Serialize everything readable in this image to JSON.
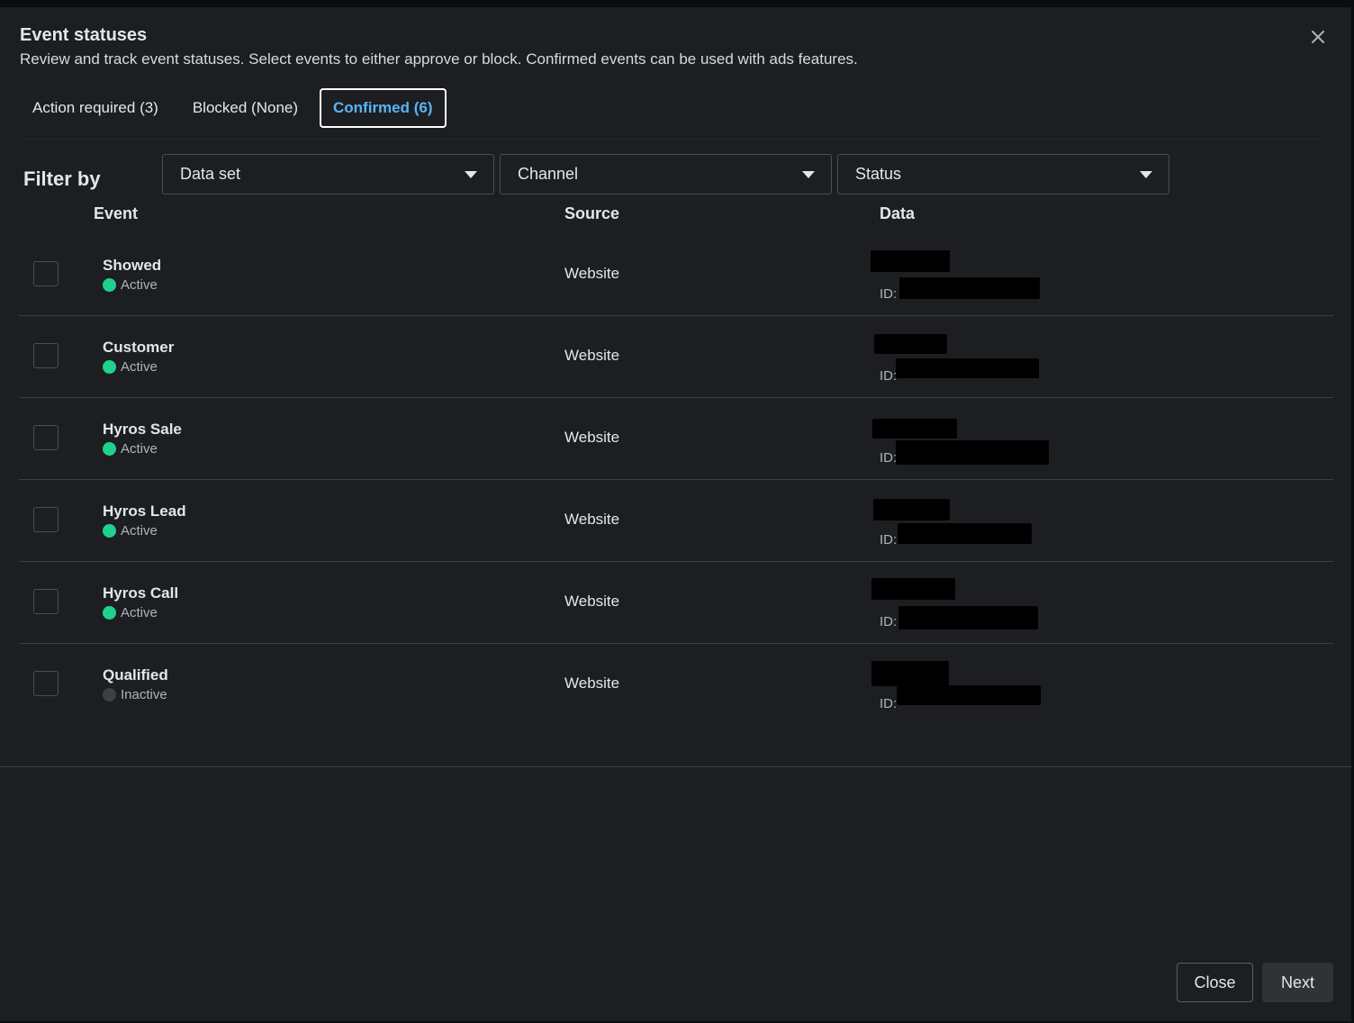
{
  "modal": {
    "title": "Event statuses",
    "subtitle": "Review and track event statuses. Select events to either approve or block. Confirmed events can be used with ads features."
  },
  "tabs": [
    {
      "label": "Action required (3)",
      "active": false
    },
    {
      "label": "Blocked (None)",
      "active": false
    },
    {
      "label": "Confirmed (6)",
      "active": true
    }
  ],
  "filter": {
    "label": "Filter by",
    "dropdowns": [
      {
        "label": "Data set"
      },
      {
        "label": "Channel"
      },
      {
        "label": "Status"
      }
    ]
  },
  "table": {
    "columns": {
      "event": "Event",
      "source": "Source",
      "data": "Data"
    },
    "id_label": "ID:",
    "rows": [
      {
        "name": "Showed",
        "status": "Active",
        "source": "Website"
      },
      {
        "name": "Customer",
        "status": "Active",
        "source": "Website"
      },
      {
        "name": "Hyros Sale",
        "status": "Active",
        "source": "Website"
      },
      {
        "name": "Hyros Lead",
        "status": "Active",
        "source": "Website"
      },
      {
        "name": "Hyros Call",
        "status": "Active",
        "source": "Website"
      },
      {
        "name": "Qualified",
        "status": "Inactive",
        "source": "Website"
      }
    ]
  },
  "footer": {
    "close_label": "Close",
    "next_label": "Next"
  },
  "colors": {
    "active": "#1fd18d",
    "inactive": "#3e4045",
    "accent": "#5ab4f6"
  },
  "icons": {
    "close": "close-icon",
    "dropdown": "caret-down-icon"
  }
}
